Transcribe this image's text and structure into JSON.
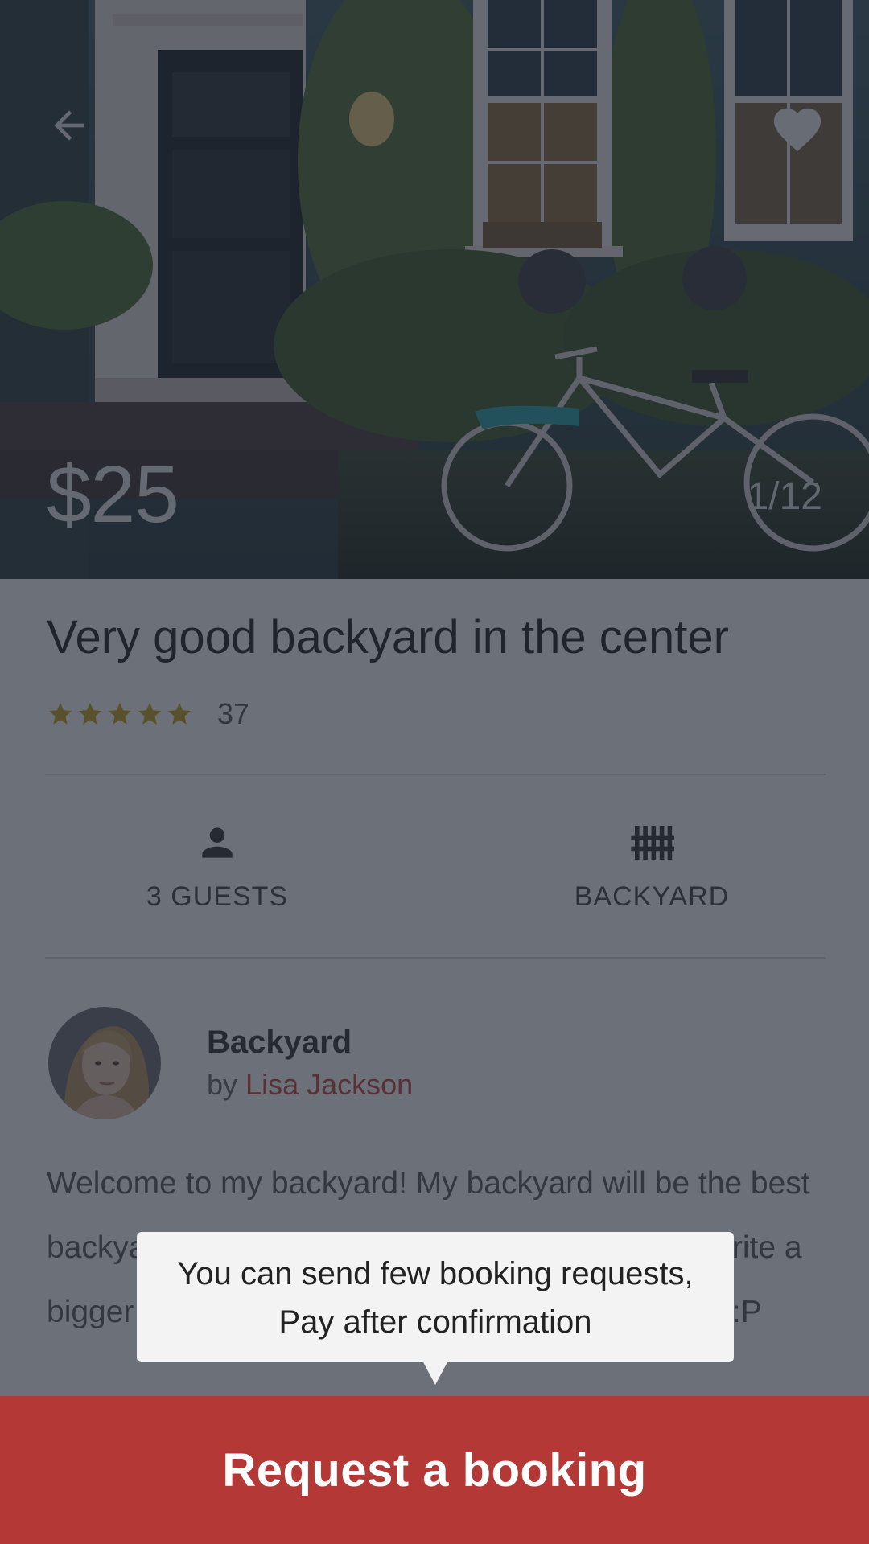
{
  "hero": {
    "price": "$25",
    "photo_counter": "1/12",
    "back_icon": "arrow-left-icon",
    "favorite_icon": "heart-icon"
  },
  "listing": {
    "title": "Very good backyard in the center",
    "rating": {
      "stars": 5,
      "star_color": "#c7a21b",
      "count": "37"
    },
    "features": [
      {
        "icon": "person-icon",
        "label": "3 GUESTS"
      },
      {
        "icon": "fence-icon",
        "label": "BACKYARD"
      }
    ],
    "host": {
      "type": "Backyard",
      "by_prefix": "by",
      "name": "Lisa Jackson",
      "name_color": "#c8413b"
    },
    "description": "Welcome to my backyard! My backyard will be the best backyard of your life! I hope you like it :) I could write a bigger description but I just have no time :D Cya! :P"
  },
  "tooltip": {
    "line1": "You can send few booking requests,",
    "line2": "Pay after confirmation"
  },
  "cta": {
    "label": "Request a booking",
    "color": "#b43836"
  }
}
